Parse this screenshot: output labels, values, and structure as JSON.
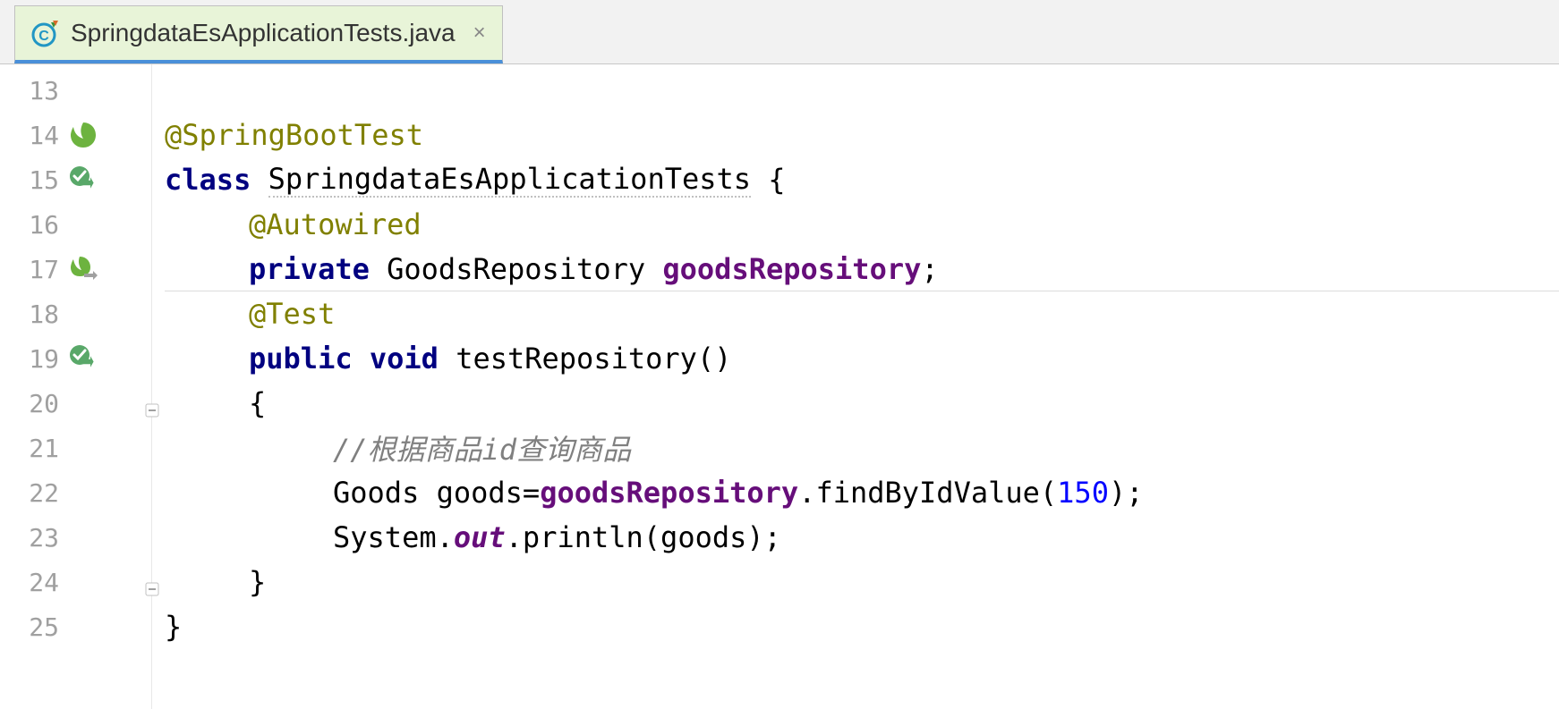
{
  "tab": {
    "title": "SpringdataEsApplicationTests.java",
    "close_glyph": "×"
  },
  "gutter": {
    "line_numbers": [
      "13",
      "14",
      "15",
      "16",
      "17",
      "18",
      "19",
      "20",
      "21",
      "22",
      "23",
      "24",
      "25"
    ]
  },
  "code": {
    "l14": {
      "annotation": "@SpringBootTest"
    },
    "l15": {
      "kw_class": "class",
      "class_name": "SpringdataEsApplicationTests",
      "brace": " {"
    },
    "l16": {
      "annotation": "@Autowired"
    },
    "l17": {
      "kw_private": "private",
      "type": "GoodsRepository",
      "field": "goodsRepository",
      "semi": ";"
    },
    "l18": {
      "annotation": "@Test"
    },
    "l19": {
      "kw_public": "public",
      "kw_void": "void",
      "method": "testRepository",
      "parens": "()"
    },
    "l20": {
      "brace": "{"
    },
    "l21": {
      "comment": "//根据商品id查询商品"
    },
    "l22": {
      "type": "Goods",
      "var": "goods",
      "eq": "=",
      "field": "goodsRepository",
      "dot1": ".",
      "method": "findByIdValue",
      "open": "(",
      "num": "150",
      "close": ");"
    },
    "l23": {
      "sys": "System",
      "dot1": ".",
      "out": "out",
      "dot2": ".",
      "println": "println",
      "open": "(",
      "arg": "goods",
      "close": ");"
    },
    "l24": {
      "brace": "}"
    },
    "l25": {
      "brace": "}"
    }
  }
}
